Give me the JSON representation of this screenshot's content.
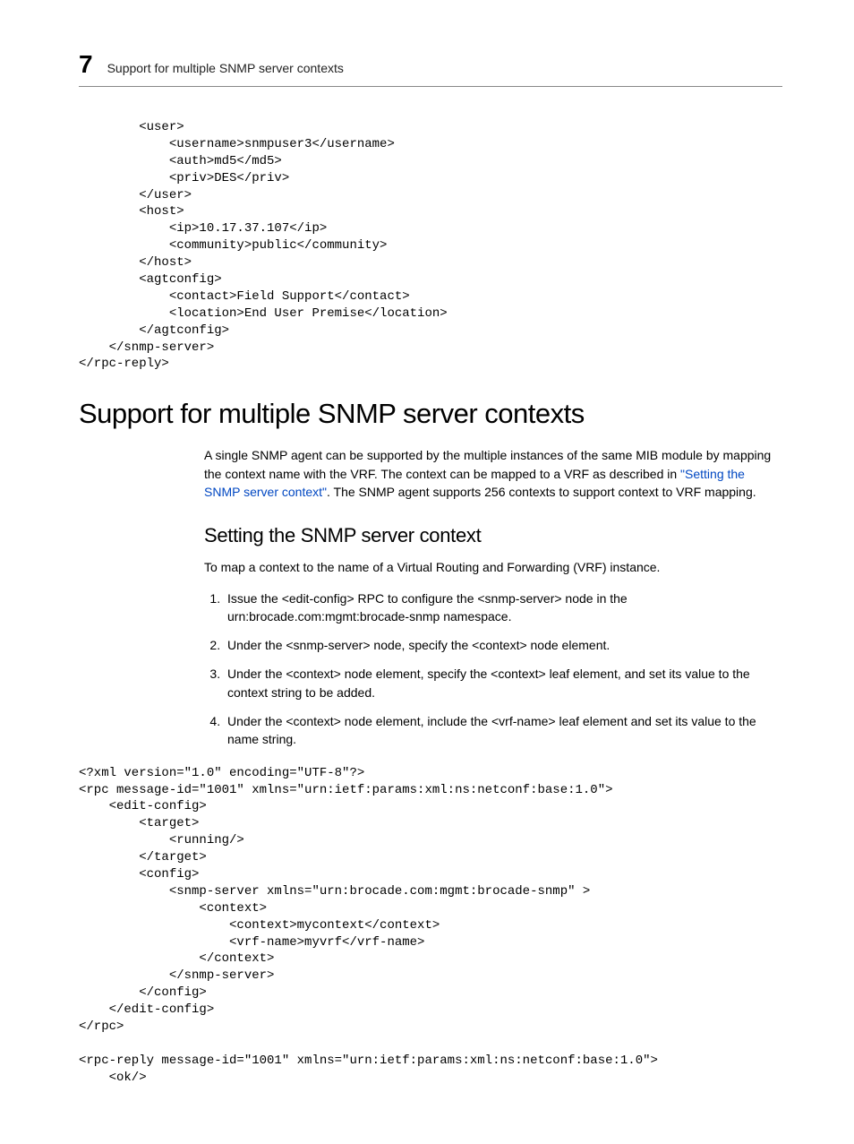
{
  "header": {
    "chapter_number": "7",
    "title": "Support for multiple SNMP server contexts"
  },
  "code_block_top": "        <user>\n            <username>snmpuser3</username>\n            <auth>md5</md5>\n            <priv>DES</priv>\n        </user>\n        <host>\n            <ip>10.17.37.107</ip>\n            <community>public</community>\n        </host>\n        <agtconfig>\n            <contact>Field Support</contact>\n            <location>End User Premise</location>\n        </agtconfig>\n    </snmp-server>\n</rpc-reply>",
  "h1": "Support for multiple SNMP server contexts",
  "intro": {
    "p1a": "A single SNMP agent can be supported by the multiple instances of the same MIB module by mapping the context name with the VRF. The context can be mapped to a VRF as described in ",
    "link": "\"Setting the SNMP server context\"",
    "p1b": ". The SNMP agent supports 256 contexts to support context to VRF mapping."
  },
  "h2": "Setting the SNMP server context",
  "sub_intro": "To map a context to the name of a Virtual Routing and Forwarding (VRF) instance.",
  "steps": [
    "Issue the <edit-config> RPC to configure the <snmp-server> node in the urn:brocade.com:mgmt:brocade-snmp namespace.",
    "Under the <snmp-server> node, specify the <context> node element.",
    "Under the <context> node element, specify the <context> leaf element, and set its value to the context string to be added.",
    "Under the <context> node element, include the <vrf-name> leaf element and set its value to the name string."
  ],
  "code_block_bottom": "<?xml version=\"1.0\" encoding=\"UTF-8\"?>\n<rpc message-id=\"1001\" xmlns=\"urn:ietf:params:xml:ns:netconf:base:1.0\">\n    <edit-config>\n        <target>\n            <running/>\n        </target>\n        <config>\n            <snmp-server xmlns=\"urn:brocade.com:mgmt:brocade-snmp\" >\n                <context>\n                    <context>mycontext</context>\n                    <vrf-name>myvrf</vrf-name>\n                </context>\n            </snmp-server>\n        </config>\n    </edit-config>\n</rpc>\n\n<rpc-reply message-id=\"1001\" xmlns=\"urn:ietf:params:xml:ns:netconf:base:1.0\">\n    <ok/>"
}
